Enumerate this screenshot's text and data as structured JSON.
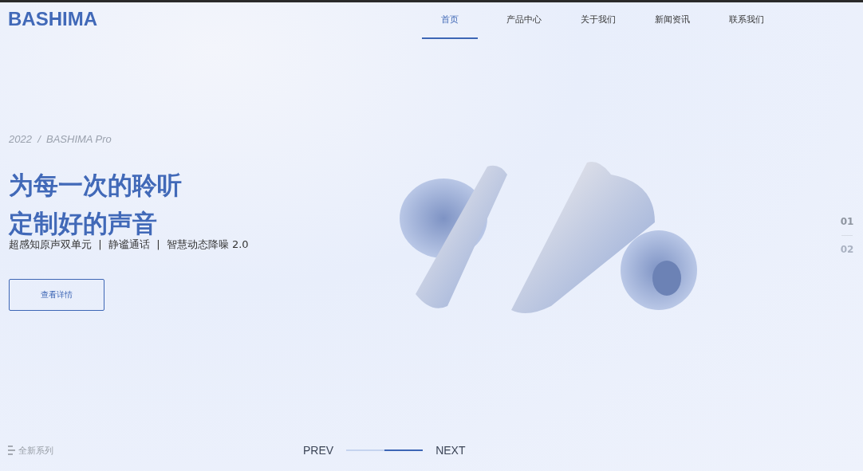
{
  "logo": "BASHIMA",
  "nav": [
    {
      "label": "首页",
      "selected": true
    },
    {
      "label": "产品中心",
      "selected": false
    },
    {
      "label": "关于我们",
      "selected": false
    },
    {
      "label": "新闻资讯",
      "selected": false
    },
    {
      "label": "联系我们",
      "selected": false
    }
  ],
  "hero": {
    "eyebrow": "2022  /  BASHIMA Pro",
    "headline": [
      "为每一次的聆听",
      "定制好的声音"
    ],
    "features": "超感知原声双单元  |  静谧通话  |  智慧动态降噪 2.0",
    "button": "查看详情"
  },
  "slides": [
    {
      "label": "01",
      "selected": true
    },
    {
      "label": "02",
      "selected": false
    }
  ],
  "series_label": "全新系列",
  "pager": {
    "prev": "PREV",
    "next": "NEXT",
    "level": 0.5
  }
}
